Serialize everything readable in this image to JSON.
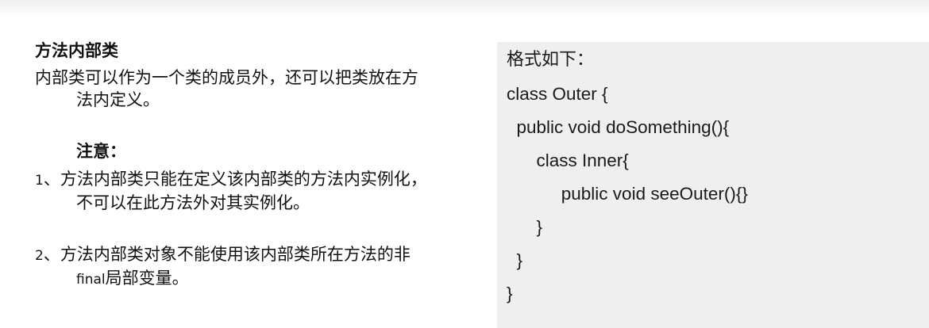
{
  "left": {
    "title": "方法内部类",
    "intro_line1": "内部类可以作为一个类的成员外，还可以把类放在方",
    "intro_line2": "法内定义。",
    "note": "注意：",
    "item1_num": "1",
    "item1_line1": "、方法内部类只能在定义该内部类的方法内实例化，",
    "item1_line2": "不可以在此方法外对其实例化。",
    "item2_num": "2",
    "item2_line1": "、方法内部类对象不能使用该内部类所在方法的非",
    "item2_line2_prefix": "final",
    "item2_line2_rest": "局部变量。"
  },
  "right": {
    "heading": "格式如下：",
    "code": [
      "class Outer {",
      "  public void doSomething(){",
      "      class Inner{",
      "           public void seeOuter(){}",
      "      }",
      "  }",
      "}"
    ]
  }
}
